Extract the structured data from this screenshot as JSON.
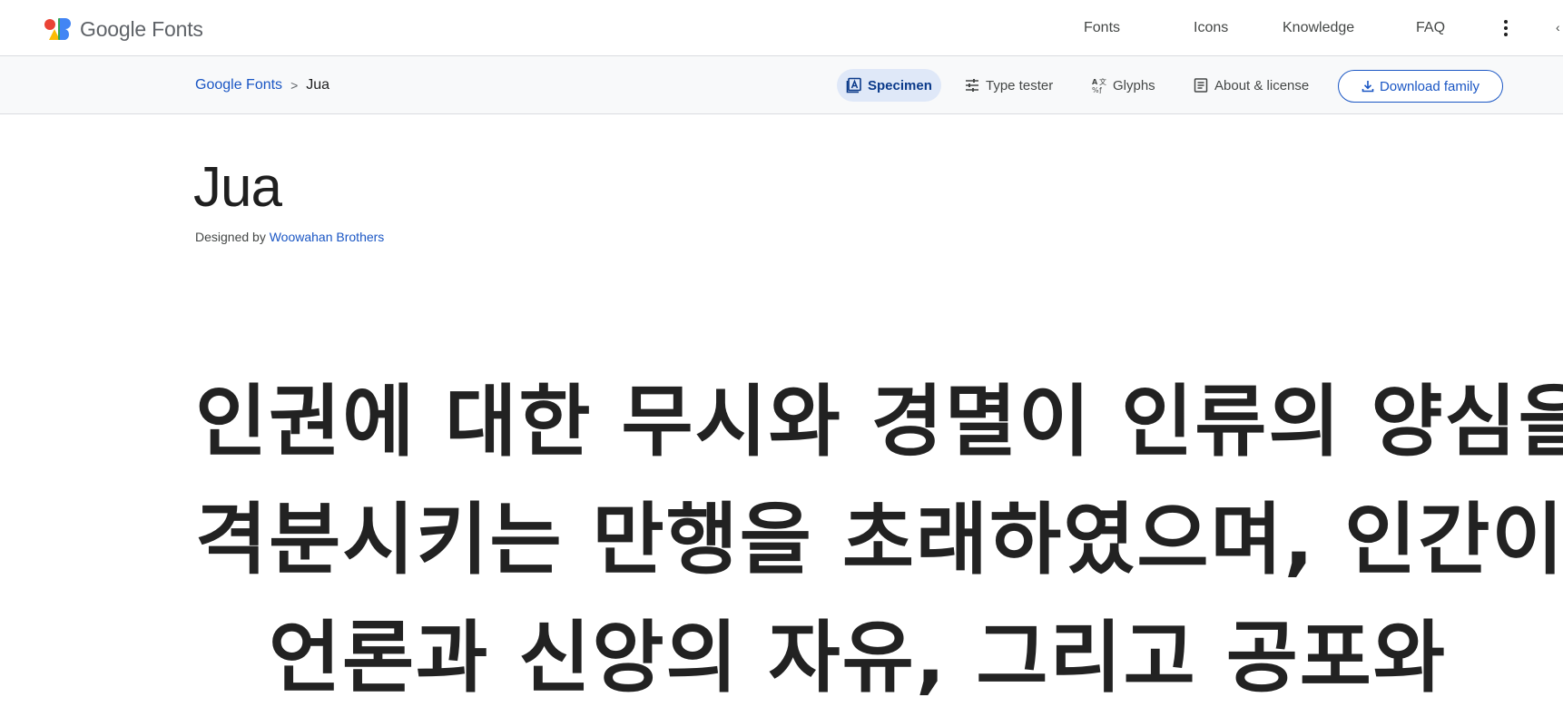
{
  "app": {
    "logo_text": "Google Fonts",
    "brand_colors": [
      "#ea4335",
      "#fbbc04",
      "#34a853",
      "#4285f4"
    ]
  },
  "topnav": {
    "items": [
      {
        "label": "Fonts"
      },
      {
        "label": "Icons"
      },
      {
        "label": "Knowledge"
      },
      {
        "label": "FAQ"
      }
    ],
    "more_icon": "more-vert-icon"
  },
  "breadcrumb": {
    "root": "Google Fonts",
    "separator": ">",
    "current": "Jua"
  },
  "tabs": [
    {
      "label": "Specimen",
      "icon": "specimen-icon",
      "active": true
    },
    {
      "label": "Type tester",
      "icon": "tune-icon",
      "active": false
    },
    {
      "label": "Glyphs",
      "icon": "glyphs-icon",
      "active": false
    },
    {
      "label": "About & license",
      "icon": "article-icon",
      "active": false
    }
  ],
  "download": {
    "label": "Download family",
    "icon": "download-icon"
  },
  "font": {
    "name": "Jua",
    "designed_by_prefix": "Designed by",
    "designer": "Woowahan Brothers"
  },
  "specimen": {
    "lines": [
      "인권에 대한 무시와 경멸이 인류의 양심을",
      "격분시키는 만행을 초래하였으며, 인간이",
      "언론과 신앙의 자유, 그리고 공포와"
    ]
  },
  "colors": {
    "accent": "#1a56c4",
    "active_tab_bg": "#dfe8f8",
    "subbar_bg": "#f8f9fa"
  }
}
